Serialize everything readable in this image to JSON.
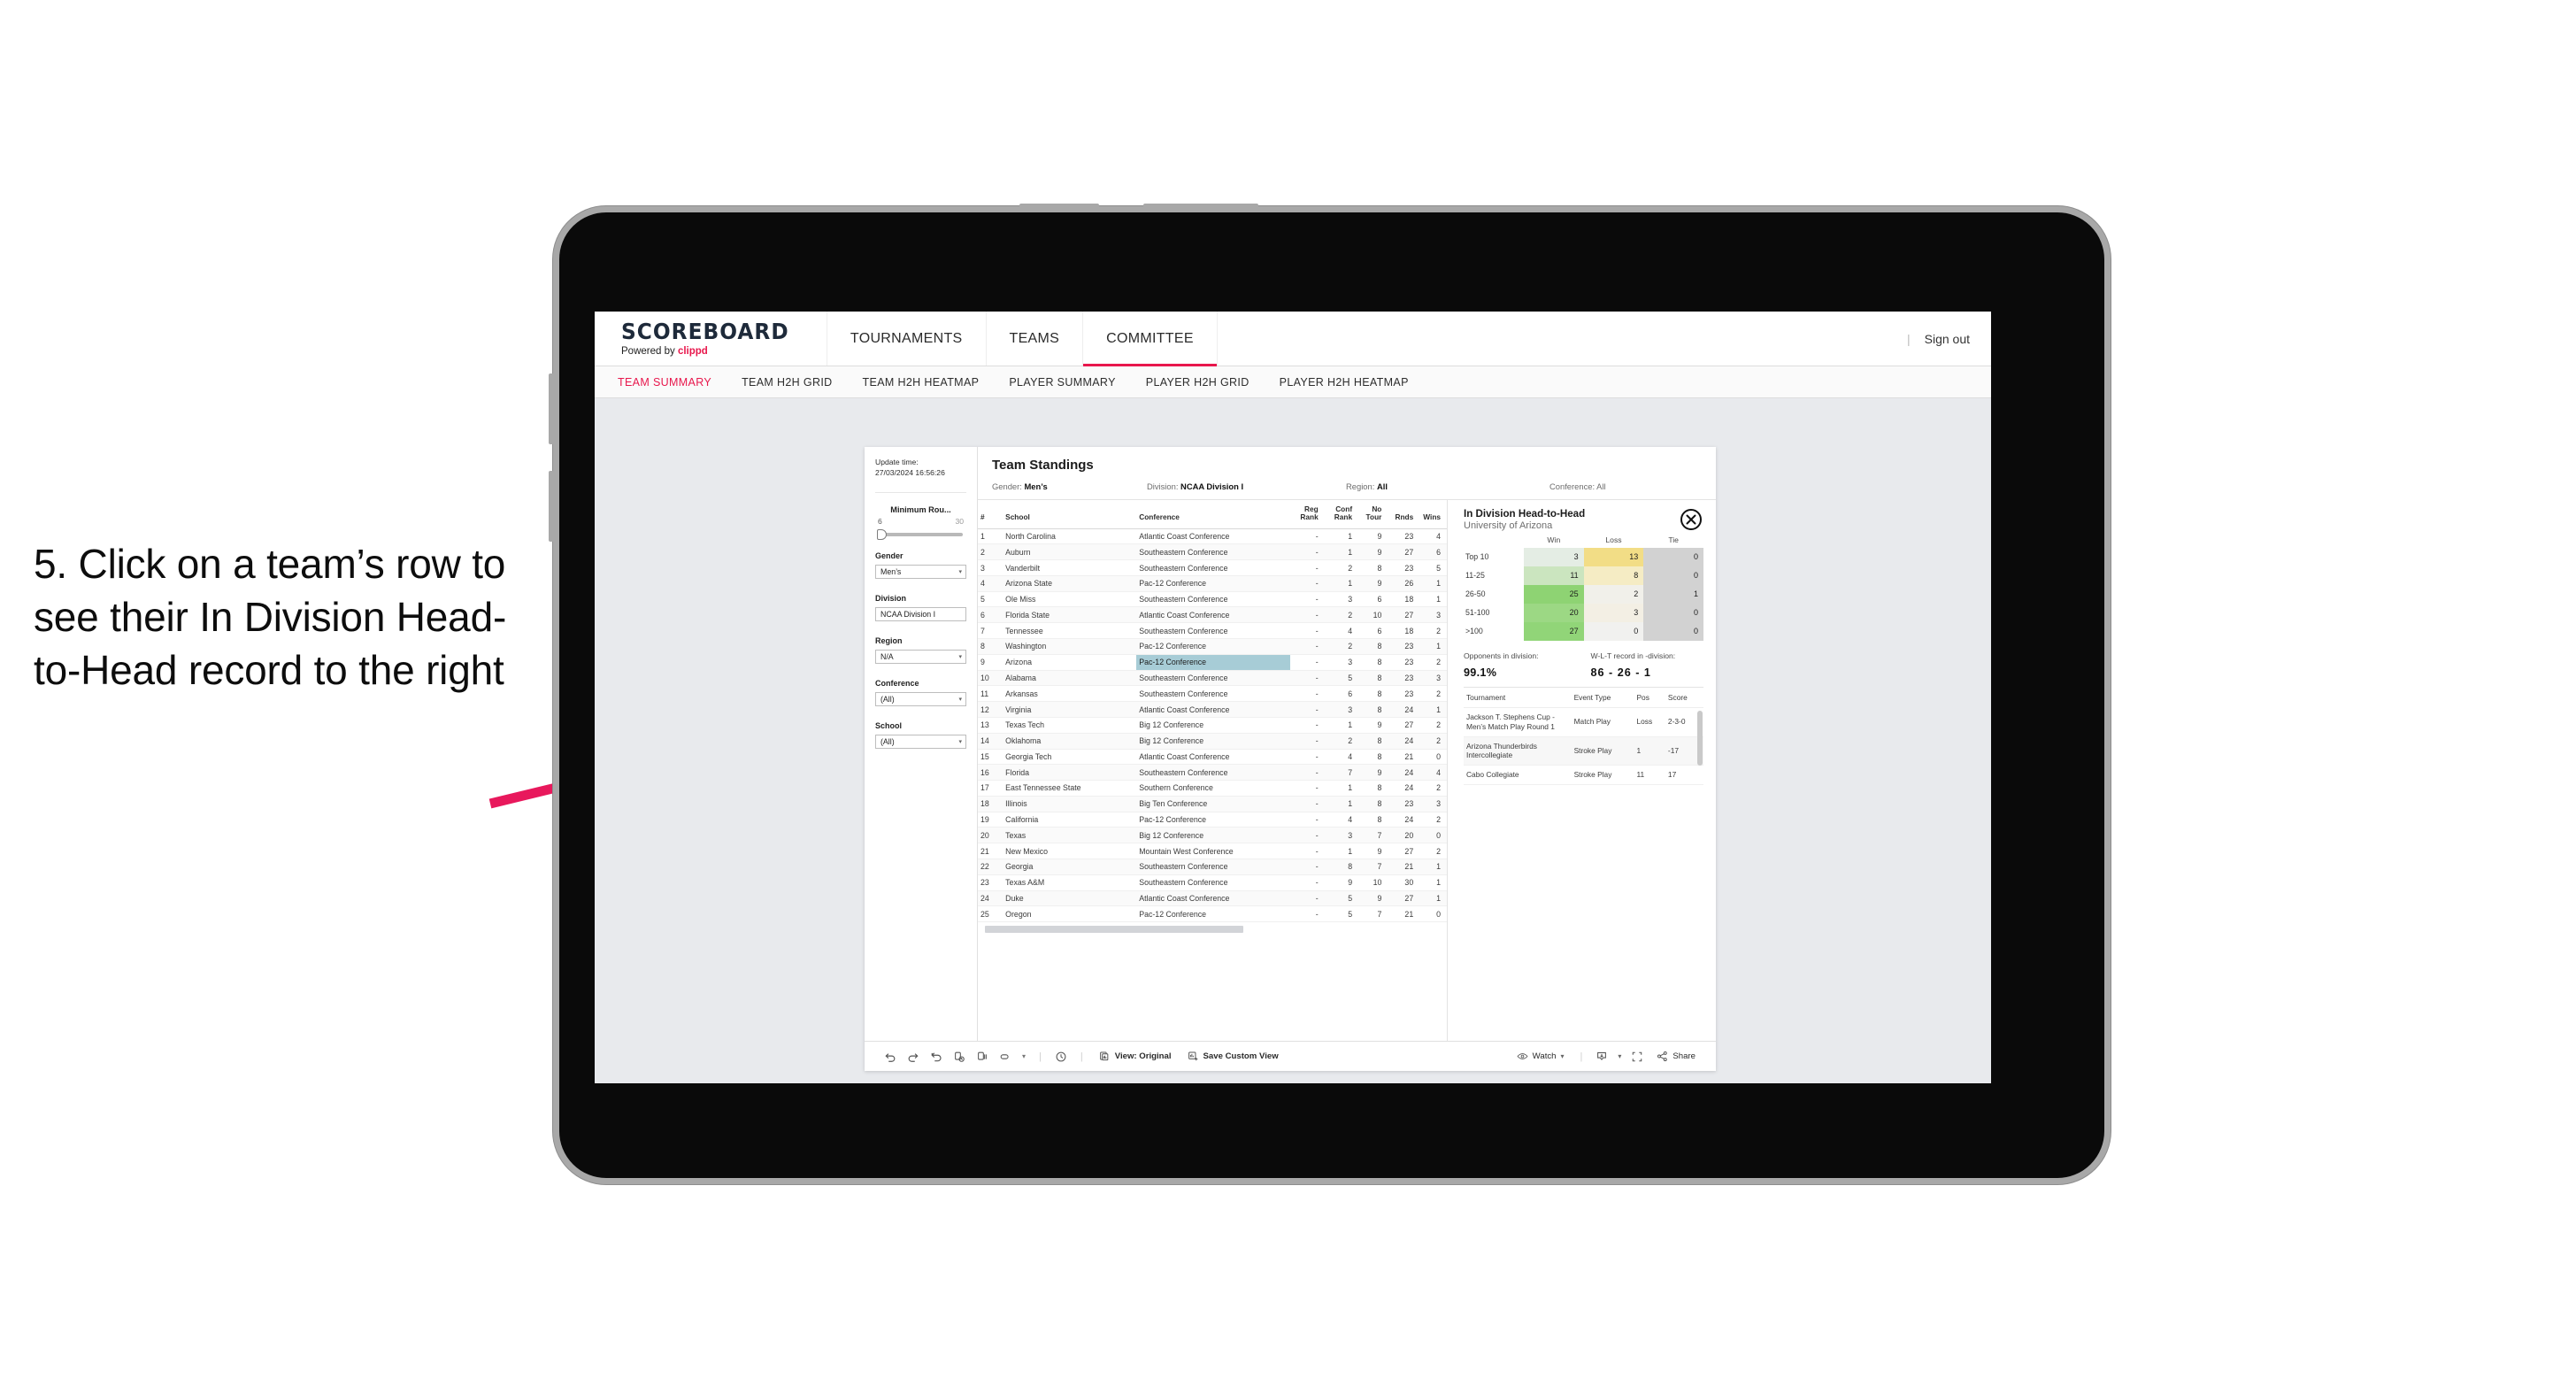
{
  "annotation": {
    "text": "5. Click on a team’s row to see their In Division Head-to-Head record to the right",
    "arrow_color": "#e8185c"
  },
  "header": {
    "brand_title": "SCOREBOARD",
    "brand_sub_prefix": "Powered by ",
    "brand_sub_accent": "clippd",
    "nav": [
      {
        "label": "TOURNAMENTS",
        "active": false
      },
      {
        "label": "TEAMS",
        "active": false
      },
      {
        "label": "COMMITTEE",
        "active": true
      }
    ],
    "divider": "|",
    "sign_out": "Sign out",
    "accent_color": "#e8174c"
  },
  "subnav": [
    {
      "label": "TEAM SUMMARY",
      "active": true
    },
    {
      "label": "TEAM H2H GRID",
      "active": false
    },
    {
      "label": "TEAM H2H HEATMAP",
      "active": false
    },
    {
      "label": "PLAYER SUMMARY",
      "active": false
    },
    {
      "label": "PLAYER H2H GRID",
      "active": false
    },
    {
      "label": "PLAYER H2H HEATMAP",
      "active": false
    }
  ],
  "filters": {
    "update_time_label": "Update time:",
    "update_time_value": "27/03/2024 16:56:26",
    "slider": {
      "label": "Minimum Rou...",
      "min": "6",
      "max": "30"
    },
    "selects": [
      {
        "label": "Gender",
        "value": "Men’s",
        "has_caret": true
      },
      {
        "label": "Division",
        "value": "NCAA Division I",
        "has_caret": false
      },
      {
        "label": "Region",
        "value": "N/A",
        "has_caret": true
      },
      {
        "label": "Conference",
        "value": "(All)",
        "has_caret": true
      },
      {
        "label": "School",
        "value": "(All)",
        "has_caret": true
      }
    ]
  },
  "standings": {
    "title": "Team Standings",
    "summary": [
      {
        "label": "Gender:",
        "value": "Men’s"
      },
      {
        "label": "Division:",
        "value": "NCAA Division I"
      },
      {
        "label": "Region:",
        "value": "All"
      },
      {
        "label": "Conference:",
        "value": "All"
      }
    ],
    "columns": [
      "#",
      "School",
      "Conference",
      "Reg Rank",
      "Conf Rank",
      "No Tour",
      "Rnds",
      "Wins"
    ],
    "highlighted_row_index": 8,
    "highlight_color": "#a7ccd6",
    "rows": [
      {
        "rank": "1",
        "school": "North Carolina",
        "conference": "Atlantic Coast Conference",
        "reg": "-",
        "conf": "1",
        "notour": "9",
        "rnds": "23",
        "wins": "4"
      },
      {
        "rank": "2",
        "school": "Auburn",
        "conference": "Southeastern Conference",
        "reg": "-",
        "conf": "1",
        "notour": "9",
        "rnds": "27",
        "wins": "6"
      },
      {
        "rank": "3",
        "school": "Vanderbilt",
        "conference": "Southeastern Conference",
        "reg": "-",
        "conf": "2",
        "notour": "8",
        "rnds": "23",
        "wins": "5"
      },
      {
        "rank": "4",
        "school": "Arizona State",
        "conference": "Pac-12 Conference",
        "reg": "-",
        "conf": "1",
        "notour": "9",
        "rnds": "26",
        "wins": "1"
      },
      {
        "rank": "5",
        "school": "Ole Miss",
        "conference": "Southeastern Conference",
        "reg": "-",
        "conf": "3",
        "notour": "6",
        "rnds": "18",
        "wins": "1"
      },
      {
        "rank": "6",
        "school": "Florida State",
        "conference": "Atlantic Coast Conference",
        "reg": "-",
        "conf": "2",
        "notour": "10",
        "rnds": "27",
        "wins": "3"
      },
      {
        "rank": "7",
        "school": "Tennessee",
        "conference": "Southeastern Conference",
        "reg": "-",
        "conf": "4",
        "notour": "6",
        "rnds": "18",
        "wins": "2"
      },
      {
        "rank": "8",
        "school": "Washington",
        "conference": "Pac-12 Conference",
        "reg": "-",
        "conf": "2",
        "notour": "8",
        "rnds": "23",
        "wins": "1"
      },
      {
        "rank": "9",
        "school": "Arizona",
        "conference": "Pac-12 Conference",
        "reg": "-",
        "conf": "3",
        "notour": "8",
        "rnds": "23",
        "wins": "2"
      },
      {
        "rank": "10",
        "school": "Alabama",
        "conference": "Southeastern Conference",
        "reg": "-",
        "conf": "5",
        "notour": "8",
        "rnds": "23",
        "wins": "3"
      },
      {
        "rank": "11",
        "school": "Arkansas",
        "conference": "Southeastern Conference",
        "reg": "-",
        "conf": "6",
        "notour": "8",
        "rnds": "23",
        "wins": "2"
      },
      {
        "rank": "12",
        "school": "Virginia",
        "conference": "Atlantic Coast Conference",
        "reg": "-",
        "conf": "3",
        "notour": "8",
        "rnds": "24",
        "wins": "1"
      },
      {
        "rank": "13",
        "school": "Texas Tech",
        "conference": "Big 12 Conference",
        "reg": "-",
        "conf": "1",
        "notour": "9",
        "rnds": "27",
        "wins": "2"
      },
      {
        "rank": "14",
        "school": "Oklahoma",
        "conference": "Big 12 Conference",
        "reg": "-",
        "conf": "2",
        "notour": "8",
        "rnds": "24",
        "wins": "2"
      },
      {
        "rank": "15",
        "school": "Georgia Tech",
        "conference": "Atlantic Coast Conference",
        "reg": "-",
        "conf": "4",
        "notour": "8",
        "rnds": "21",
        "wins": "0"
      },
      {
        "rank": "16",
        "school": "Florida",
        "conference": "Southeastern Conference",
        "reg": "-",
        "conf": "7",
        "notour": "9",
        "rnds": "24",
        "wins": "4"
      },
      {
        "rank": "17",
        "school": "East Tennessee State",
        "conference": "Southern Conference",
        "reg": "-",
        "conf": "1",
        "notour": "8",
        "rnds": "24",
        "wins": "2"
      },
      {
        "rank": "18",
        "school": "Illinois",
        "conference": "Big Ten Conference",
        "reg": "-",
        "conf": "1",
        "notour": "8",
        "rnds": "23",
        "wins": "3"
      },
      {
        "rank": "19",
        "school": "California",
        "conference": "Pac-12 Conference",
        "reg": "-",
        "conf": "4",
        "notour": "8",
        "rnds": "24",
        "wins": "2"
      },
      {
        "rank": "20",
        "school": "Texas",
        "conference": "Big 12 Conference",
        "reg": "-",
        "conf": "3",
        "notour": "7",
        "rnds": "20",
        "wins": "0"
      },
      {
        "rank": "21",
        "school": "New Mexico",
        "conference": "Mountain West Conference",
        "reg": "-",
        "conf": "1",
        "notour": "9",
        "rnds": "27",
        "wins": "2"
      },
      {
        "rank": "22",
        "school": "Georgia",
        "conference": "Southeastern Conference",
        "reg": "-",
        "conf": "8",
        "notour": "7",
        "rnds": "21",
        "wins": "1"
      },
      {
        "rank": "23",
        "school": "Texas A&M",
        "conference": "Southeastern Conference",
        "reg": "-",
        "conf": "9",
        "notour": "10",
        "rnds": "30",
        "wins": "1"
      },
      {
        "rank": "24",
        "school": "Duke",
        "conference": "Atlantic Coast Conference",
        "reg": "-",
        "conf": "5",
        "notour": "9",
        "rnds": "27",
        "wins": "1"
      },
      {
        "rank": "25",
        "school": "Oregon",
        "conference": "Pac-12 Conference",
        "reg": "-",
        "conf": "5",
        "notour": "7",
        "rnds": "21",
        "wins": "0"
      }
    ]
  },
  "detail": {
    "title": "In Division Head-to-Head",
    "subtitle": "University of Arizona",
    "close_icon": "close-icon",
    "h2h": {
      "columns": [
        "Win",
        "Loss",
        "Tie"
      ],
      "rows": [
        {
          "bucket": "Top 10",
          "win": "3",
          "loss": "13",
          "tie": "0",
          "win_color": "#e4ede4",
          "loss_color": "#f2dd86",
          "tie_color": "#d2d2d2"
        },
        {
          "bucket": "11-25",
          "win": "11",
          "loss": "8",
          "tie": "0",
          "win_color": "#cbe5bf",
          "loss_color": "#f5ecc4",
          "tie_color": "#d2d2d2"
        },
        {
          "bucket": "26-50",
          "win": "25",
          "loss": "2",
          "tie": "1",
          "win_color": "#8ed373",
          "loss_color": "#f1f0ea",
          "tie_color": "#d2d2d2"
        },
        {
          "bucket": "51-100",
          "win": "20",
          "loss": "3",
          "tie": "0",
          "win_color": "#9cd884",
          "loss_color": "#f3efe4",
          "tie_color": "#d2d2d2"
        },
        {
          "bucket": ">100",
          "win": "27",
          "loss": "0",
          "tie": "0",
          "win_color": "#91d578",
          "loss_color": "#f1f1ef",
          "tie_color": "#d2d2d2"
        }
      ]
    },
    "summary": [
      {
        "label": "Opponents in division:",
        "value": "99.1%"
      },
      {
        "label": "W-L-T record in -division:",
        "value": "86 - 26 - 1"
      }
    ],
    "tournaments": {
      "columns": [
        "Tournament",
        "Event Type",
        "Pos",
        "Score"
      ],
      "rows": [
        {
          "name": "Jackson T. Stephens Cup - Men’s Match Play Round 1",
          "type": "Match Play",
          "pos": "Loss",
          "score": "2-3-0"
        },
        {
          "name": "Arizona Thunderbirds Intercollegiate",
          "type": "Stroke Play",
          "pos": "1",
          "score": "-17"
        },
        {
          "name": "Cabo Collegiate",
          "type": "Stroke Play",
          "pos": "11",
          "score": "17"
        }
      ]
    }
  },
  "toolbar": {
    "icons": [
      "undo-icon",
      "redo-icon",
      "revert-icon",
      "refresh-data-icon",
      "pause-updates-icon",
      "highlight-icon"
    ],
    "dropdown_caret": "▾",
    "separator": "|",
    "clock_icon": "clock-icon",
    "view_label": "View: Original",
    "view_icon": "view-icon",
    "save_label": "Save Custom View",
    "save_icon": "save-view-icon",
    "watch_label": "Watch",
    "watch_icon": "eye-icon",
    "download_icon": "download-icon",
    "fullscreen_icon": "fullscreen-icon",
    "share_label": "Share",
    "share_icon": "share-icon"
  }
}
